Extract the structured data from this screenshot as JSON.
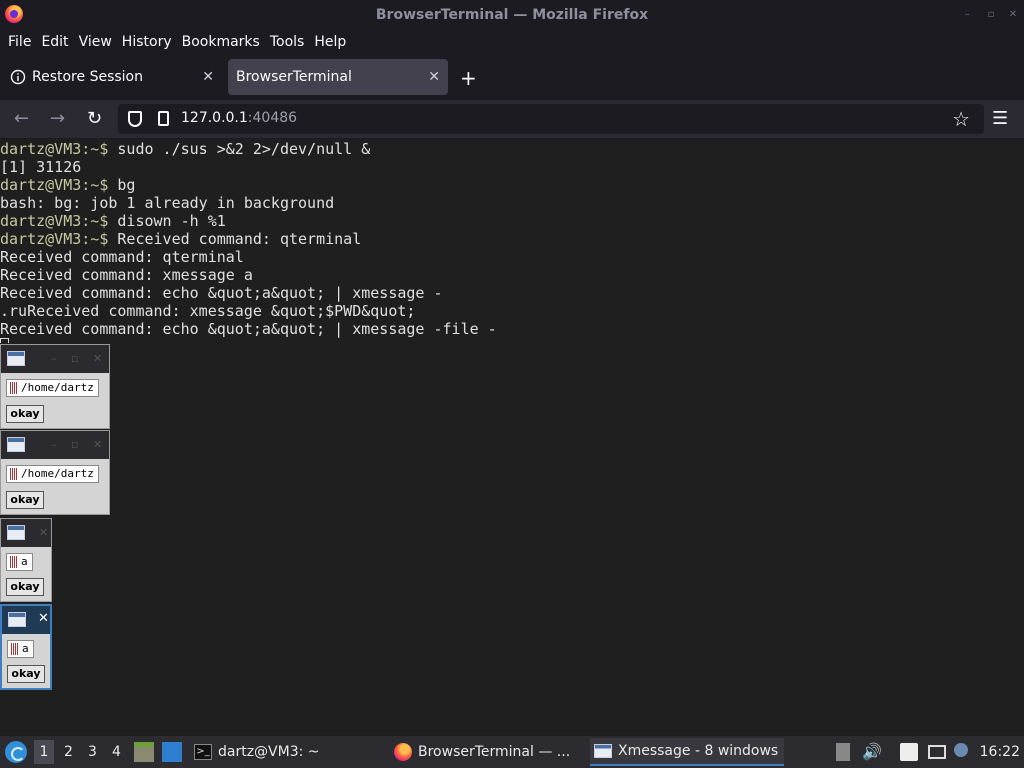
{
  "window": {
    "title": "BrowserTerminal — Mozilla Firefox"
  },
  "menu": [
    "File",
    "Edit",
    "View",
    "History",
    "Bookmarks",
    "Tools",
    "Help"
  ],
  "tabs": [
    {
      "label": "Restore Session",
      "icon": "info-icon"
    },
    {
      "label": "BrowserTerminal",
      "active": true
    }
  ],
  "urlbar": {
    "host": "127.0.0.1",
    "port": ":40486"
  },
  "terminal": {
    "lines": [
      {
        "prompt": "dartz@VM3:~$",
        "text": " sudo ./sus >&2 2>/dev/null &"
      },
      {
        "prompt": "",
        "text": "[1] 31126"
      },
      {
        "prompt": "dartz@VM3:~$",
        "text": " bg"
      },
      {
        "prompt": "",
        "text": "bash: bg: job 1 already in background"
      },
      {
        "prompt": "dartz@VM3:~$",
        "text": " disown -h %1"
      },
      {
        "prompt": "dartz@VM3:~$",
        "text": " Received command: qterminal"
      },
      {
        "prompt": "",
        "text": "Received command: qterminal"
      },
      {
        "prompt": "",
        "text": "Received command: xmessage a"
      },
      {
        "prompt": "",
        "text": "Received command: echo &quot;a&quot; | xmessage -"
      },
      {
        "prompt": "",
        "text": ".ruReceived command: xmessage &quot;$PWD&quot;"
      },
      {
        "prompt": "",
        "text": "Received command: echo &quot;a&quot; | xmessage -file -"
      }
    ]
  },
  "xmessages": [
    {
      "text": "/home/dartz",
      "button": "okay"
    },
    {
      "text": "/home/dartz",
      "button": "okay"
    },
    {
      "text": "a",
      "button": "okay"
    },
    {
      "text": "a",
      "button": "okay"
    }
  ],
  "taskbar": {
    "workspaces": [
      "1",
      "2",
      "3",
      "4"
    ],
    "tasks": [
      "dartz@VM3: ~",
      "BrowserTerminal — ...",
      "Xmessage - 8 windows"
    ],
    "clock": "16:22"
  }
}
